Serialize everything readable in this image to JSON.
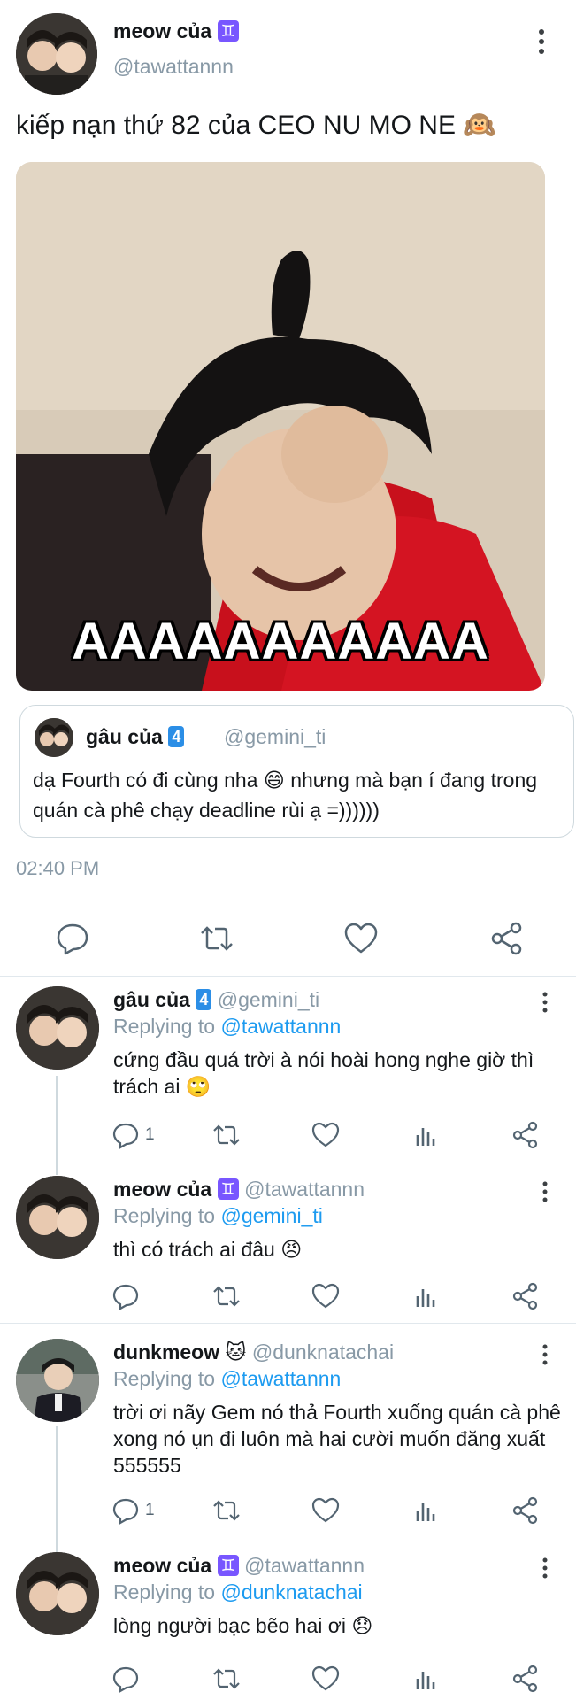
{
  "main_tweet": {
    "name": "meow của",
    "name_badge": "♊",
    "handle": "@tawattannn",
    "text": "kiếp nạn thứ 82 của CEO NU MO NE",
    "text_emoji": "🙉",
    "image_caption": "AAAAAAAAAAA",
    "time": "02:40 PM",
    "quote": {
      "name": "gâu của",
      "name_badge": "4",
      "handle": "@gemini_ti",
      "text_part1": "dạ Fourth có đi cùng nha",
      "text_emoji": "😄",
      "text_part2": "nhưng mà bạn í đang trong quán cà phê chạy deadline rùi ạ =))))))"
    },
    "actions": [
      "reply-icon",
      "retweet-icon",
      "like-icon",
      "share-icon"
    ]
  },
  "replies": [
    {
      "name": "gâu của",
      "name_badge": "4",
      "handle": "@gemini_ti",
      "replying_label": "Replying to",
      "replying_to": "@tawattannn",
      "text": "cứng đầu quá trời à nói hoài hong nghe giờ thì trách ai",
      "emoji": "🙄",
      "reply_count": "1"
    },
    {
      "name": "meow của",
      "name_badge": "♊",
      "handle": "@tawattannn",
      "replying_label": "Replying to",
      "replying_to": "@gemini_ti",
      "text": "thì có trách ai đâu",
      "emoji": "😠",
      "reply_count": ""
    },
    {
      "name": "dunkmeow",
      "name_badge": "🐱",
      "handle": "@dunknatachai",
      "replying_label": "Replying to",
      "replying_to": "@tawattannn",
      "text": "trời ơi nãy Gem nó thả Fourth xuống quán cà phê xong nó ụn đi luôn mà hai cười muốn đăng xuất 555555",
      "emoji": "",
      "reply_count": "1"
    },
    {
      "name": "meow của",
      "name_badge": "♊",
      "handle": "@tawattannn",
      "replying_label": "Replying to",
      "replying_to": "@dunknatachai",
      "text": "lòng người bạc bẽo hai ơi",
      "emoji": "😞",
      "reply_count": ""
    }
  ],
  "colors": {
    "accent": "#1d9bf0",
    "secondary_text": "#8899a6",
    "divider": "#e1e8ed",
    "gemini_badge": "#7856ff"
  }
}
